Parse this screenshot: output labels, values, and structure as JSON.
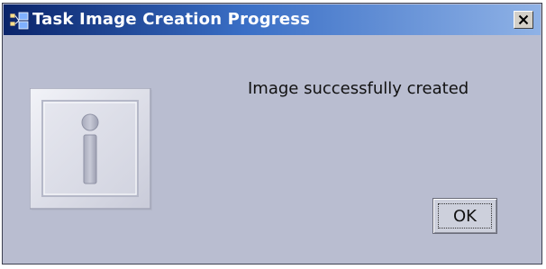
{
  "window": {
    "title": "Task Image Creation Progress",
    "title_icon": "network-computers-icon",
    "close_icon": "close-icon"
  },
  "dialog": {
    "icon": "info-icon",
    "message": "Image successfully created",
    "ok_label": "OK"
  },
  "colors": {
    "titlebar_start": "#0a246a",
    "titlebar_end": "#8fb2e6",
    "dialog_background": "#b9bdd0"
  }
}
